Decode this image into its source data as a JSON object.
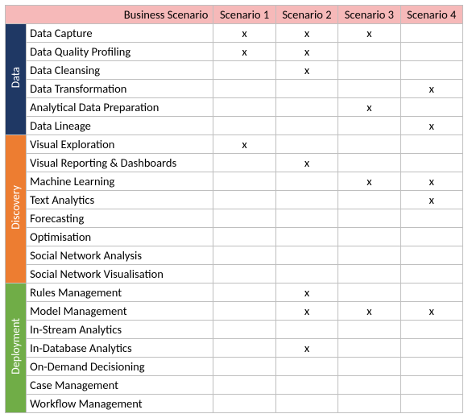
{
  "header": {
    "corner": "Business Scenario",
    "cols": [
      "Scenario 1",
      "Scenario 2",
      "Scenario 3",
      "Scenario 4"
    ]
  },
  "mark": "x",
  "categories": [
    {
      "key": "data",
      "label": "Data",
      "cls": "cat-data",
      "rows": [
        {
          "label": "Data Capture",
          "v": [
            true,
            true,
            true,
            false
          ]
        },
        {
          "label": "Data Quality Profiling",
          "v": [
            true,
            true,
            false,
            false
          ]
        },
        {
          "label": "Data Cleansing",
          "v": [
            false,
            true,
            false,
            false
          ]
        },
        {
          "label": "Data Transformation",
          "v": [
            false,
            false,
            false,
            true
          ]
        },
        {
          "label": "Analytical Data Preparation",
          "v": [
            false,
            false,
            true,
            false
          ]
        },
        {
          "label": "Data Lineage",
          "v": [
            false,
            false,
            false,
            true
          ]
        }
      ]
    },
    {
      "key": "disc",
      "label": "Discovery",
      "cls": "cat-disc",
      "rows": [
        {
          "label": "Visual Exploration",
          "v": [
            true,
            false,
            false,
            false
          ]
        },
        {
          "label": "Visual Reporting & Dashboards",
          "v": [
            false,
            true,
            false,
            false
          ]
        },
        {
          "label": "Machine Learning",
          "v": [
            false,
            false,
            true,
            true
          ]
        },
        {
          "label": "Text Analytics",
          "v": [
            false,
            false,
            false,
            true
          ]
        },
        {
          "label": "Forecasting",
          "v": [
            false,
            false,
            false,
            false
          ]
        },
        {
          "label": "Optimisation",
          "v": [
            false,
            false,
            false,
            false
          ]
        },
        {
          "label": "Social Network Analysis",
          "v": [
            false,
            false,
            false,
            false
          ]
        },
        {
          "label": "Social Network Visualisation",
          "v": [
            false,
            false,
            false,
            false
          ]
        }
      ]
    },
    {
      "key": "depl",
      "label": "Deployment",
      "cls": "cat-depl",
      "rows": [
        {
          "label": "Rules Management",
          "v": [
            false,
            true,
            false,
            false
          ]
        },
        {
          "label": "Model Management",
          "v": [
            false,
            true,
            true,
            true
          ]
        },
        {
          "label": "In-Stream Analytics",
          "v": [
            false,
            false,
            false,
            false
          ]
        },
        {
          "label": "In-Database Analytics",
          "v": [
            false,
            true,
            false,
            false
          ]
        },
        {
          "label": "On-Demand Decisioning",
          "v": [
            false,
            false,
            false,
            false
          ]
        },
        {
          "label": "Case Management",
          "v": [
            false,
            false,
            false,
            false
          ]
        },
        {
          "label": "Workflow Management",
          "v": [
            false,
            false,
            false,
            false
          ]
        }
      ]
    }
  ]
}
